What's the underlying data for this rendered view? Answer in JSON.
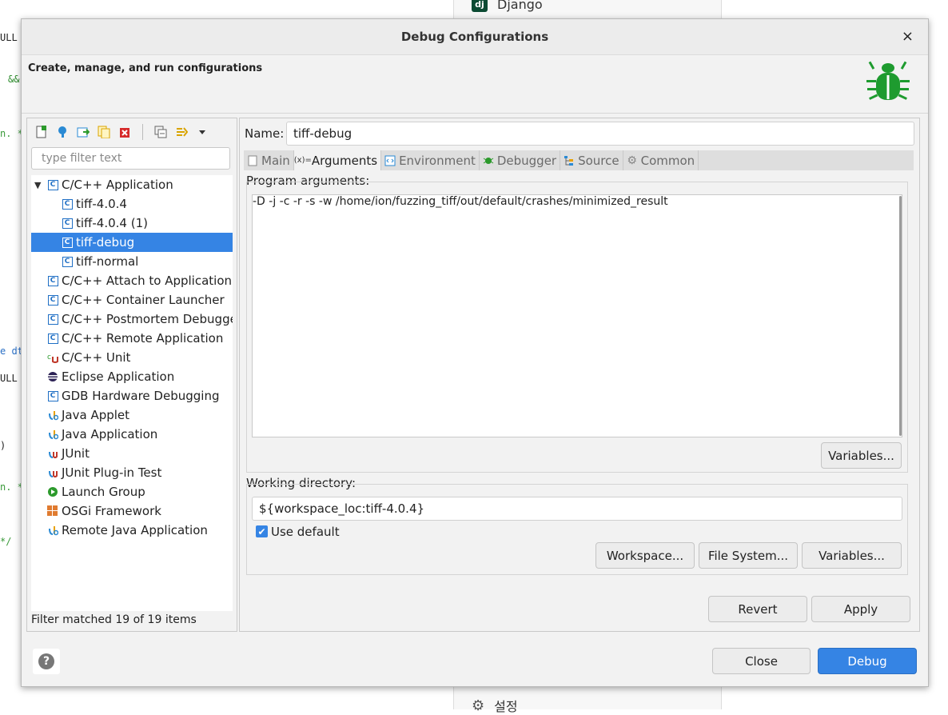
{
  "background": {
    "code_snippets": [
      "ULL",
      "&&",
      "n. *",
      "e dt",
      "ULL",
      ")",
      "n. *",
      "*/"
    ],
    "right_panel_top": "Django",
    "right_panel_bottom": "설정"
  },
  "dialog": {
    "title": "Debug Configurations",
    "close_label": "×",
    "header_text": "Create, manage, and run configurations"
  },
  "left": {
    "filter_placeholder": "type filter text",
    "tree": [
      {
        "label": "C/C++ Application",
        "icon": "c-app-icon",
        "indent": 0,
        "expanded": true
      },
      {
        "label": "tiff-4.0.4",
        "icon": "c-app-icon",
        "indent": 1
      },
      {
        "label": "tiff-4.0.4 (1)",
        "icon": "c-app-icon",
        "indent": 1
      },
      {
        "label": "tiff-debug",
        "icon": "c-app-icon",
        "indent": 1,
        "selected": true
      },
      {
        "label": "tiff-normal",
        "icon": "c-app-icon",
        "indent": 1
      },
      {
        "label": "C/C++ Attach to Application",
        "icon": "c-app-icon",
        "indent": 0
      },
      {
        "label": "C/C++ Container Launcher",
        "icon": "c-app-icon",
        "indent": 0
      },
      {
        "label": "C/C++ Postmortem Debugge",
        "icon": "c-app-icon",
        "indent": 0
      },
      {
        "label": "C/C++ Remote Application",
        "icon": "c-app-icon",
        "indent": 0
      },
      {
        "label": "C/C++ Unit",
        "icon": "c-unit-icon",
        "indent": 0
      },
      {
        "label": "Eclipse Application",
        "icon": "eclipse-icon",
        "indent": 0
      },
      {
        "label": "GDB Hardware Debugging",
        "icon": "c-app-icon",
        "indent": 0
      },
      {
        "label": "Java Applet",
        "icon": "java-icon",
        "indent": 0
      },
      {
        "label": "Java Application",
        "icon": "java-icon",
        "indent": 0
      },
      {
        "label": "JUnit",
        "icon": "junit-icon",
        "indent": 0
      },
      {
        "label": "JUnit Plug-in Test",
        "icon": "junit-icon",
        "indent": 0
      },
      {
        "label": "Launch Group",
        "icon": "launch-group-icon",
        "indent": 0
      },
      {
        "label": "OSGi Framework",
        "icon": "osgi-icon",
        "indent": 0
      },
      {
        "label": "Remote Java Application",
        "icon": "java-icon",
        "indent": 0
      }
    ],
    "status": "Filter matched 19 of 19 items"
  },
  "right": {
    "name_label": "Name:",
    "name_value": "tiff-debug",
    "tabs": [
      {
        "label": "Main",
        "icon": "main-tab-icon",
        "active": false
      },
      {
        "label": "Arguments",
        "icon": "arguments-tab-icon",
        "active": true
      },
      {
        "label": "Environment",
        "icon": "environment-tab-icon",
        "active": false
      },
      {
        "label": "Debugger",
        "icon": "debugger-tab-icon",
        "active": false
      },
      {
        "label": "Source",
        "icon": "source-tab-icon",
        "active": false
      },
      {
        "label": "Common",
        "icon": "common-tab-icon",
        "active": false
      }
    ],
    "program_args_label": "Program arguments:",
    "program_args_value": "-D -j -c -r -s -w /home/ion/fuzzing_tiff/out/default/crashes/minimized_result",
    "variables_label": "Variables...",
    "working_dir_label": "Working directory:",
    "working_dir_value": "${workspace_loc:tiff-4.0.4}",
    "use_default_label": "Use default",
    "use_default_checked": true,
    "workspace_label": "Workspace...",
    "file_system_label": "File System...",
    "wd_variables_label": "Variables...",
    "revert_label": "Revert",
    "apply_label": "Apply"
  },
  "footer": {
    "close_label": "Close",
    "debug_label": "Debug",
    "help_label": "?"
  },
  "colors": {
    "accent": "#3584e4",
    "bug_green": "#1e9b2f"
  }
}
